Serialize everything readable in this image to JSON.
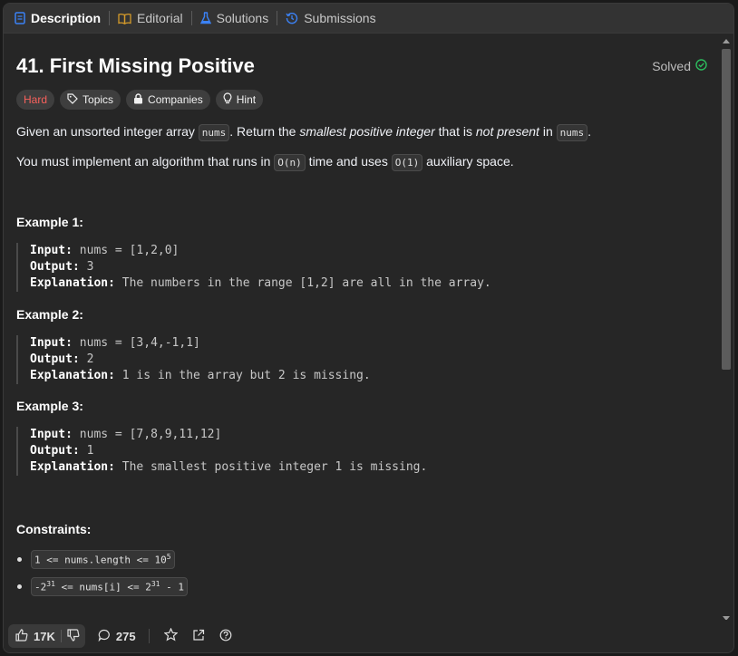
{
  "tabs": [
    {
      "label": "Description",
      "icon": "description-icon"
    },
    {
      "label": "Editorial",
      "icon": "book-icon"
    },
    {
      "label": "Solutions",
      "icon": "flask-icon"
    },
    {
      "label": "Submissions",
      "icon": "history-icon"
    }
  ],
  "problem": {
    "title": "41. First Missing Positive",
    "status": "Solved",
    "difficulty": "Hard",
    "tags": [
      "Topics",
      "Companies",
      "Hint"
    ]
  },
  "description": {
    "p1_a": "Given an unsorted integer array ",
    "p1_code1": "nums",
    "p1_b": ". Return the ",
    "p1_em1": "smallest positive integer",
    "p1_c": " that is ",
    "p1_em2": "not present",
    "p1_d": " in ",
    "p1_code2": "nums",
    "p1_e": ".",
    "p2_a": "You must implement an algorithm that runs in ",
    "p2_code1": "O(n)",
    "p2_b": " time and uses ",
    "p2_code2": "O(1)",
    "p2_c": " auxiliary space."
  },
  "examples": [
    {
      "title": "Example 1:",
      "input_label": "Input:",
      "input": "nums = [1,2,0]",
      "output_label": "Output:",
      "output": "3",
      "explanation_label": "Explanation:",
      "explanation": "The numbers in the range [1,2] are all in the array."
    },
    {
      "title": "Example 2:",
      "input_label": "Input:",
      "input": "nums = [3,4,-1,1]",
      "output_label": "Output:",
      "output": "2",
      "explanation_label": "Explanation:",
      "explanation": "1 is in the array but 2 is missing."
    },
    {
      "title": "Example 3:",
      "input_label": "Input:",
      "input": "nums = [7,8,9,11,12]",
      "output_label": "Output:",
      "output": "1",
      "explanation_label": "Explanation:",
      "explanation": "The smallest positive integer 1 is missing."
    }
  ],
  "constraints": {
    "title": "Constraints:",
    "c1_a": "1 <= nums.length <= 10",
    "c1_sup": "5",
    "c2_a": "-2",
    "c2_sup1": "31",
    "c2_b": " <= nums[i] <= 2",
    "c2_sup2": "31",
    "c2_c": " - 1"
  },
  "footer": {
    "likes": "17K",
    "comments": "275"
  },
  "colors": {
    "hard": "#f8615c",
    "solved_check": "#2cbb5d",
    "background": "#262626",
    "tabbar": "#333333"
  }
}
